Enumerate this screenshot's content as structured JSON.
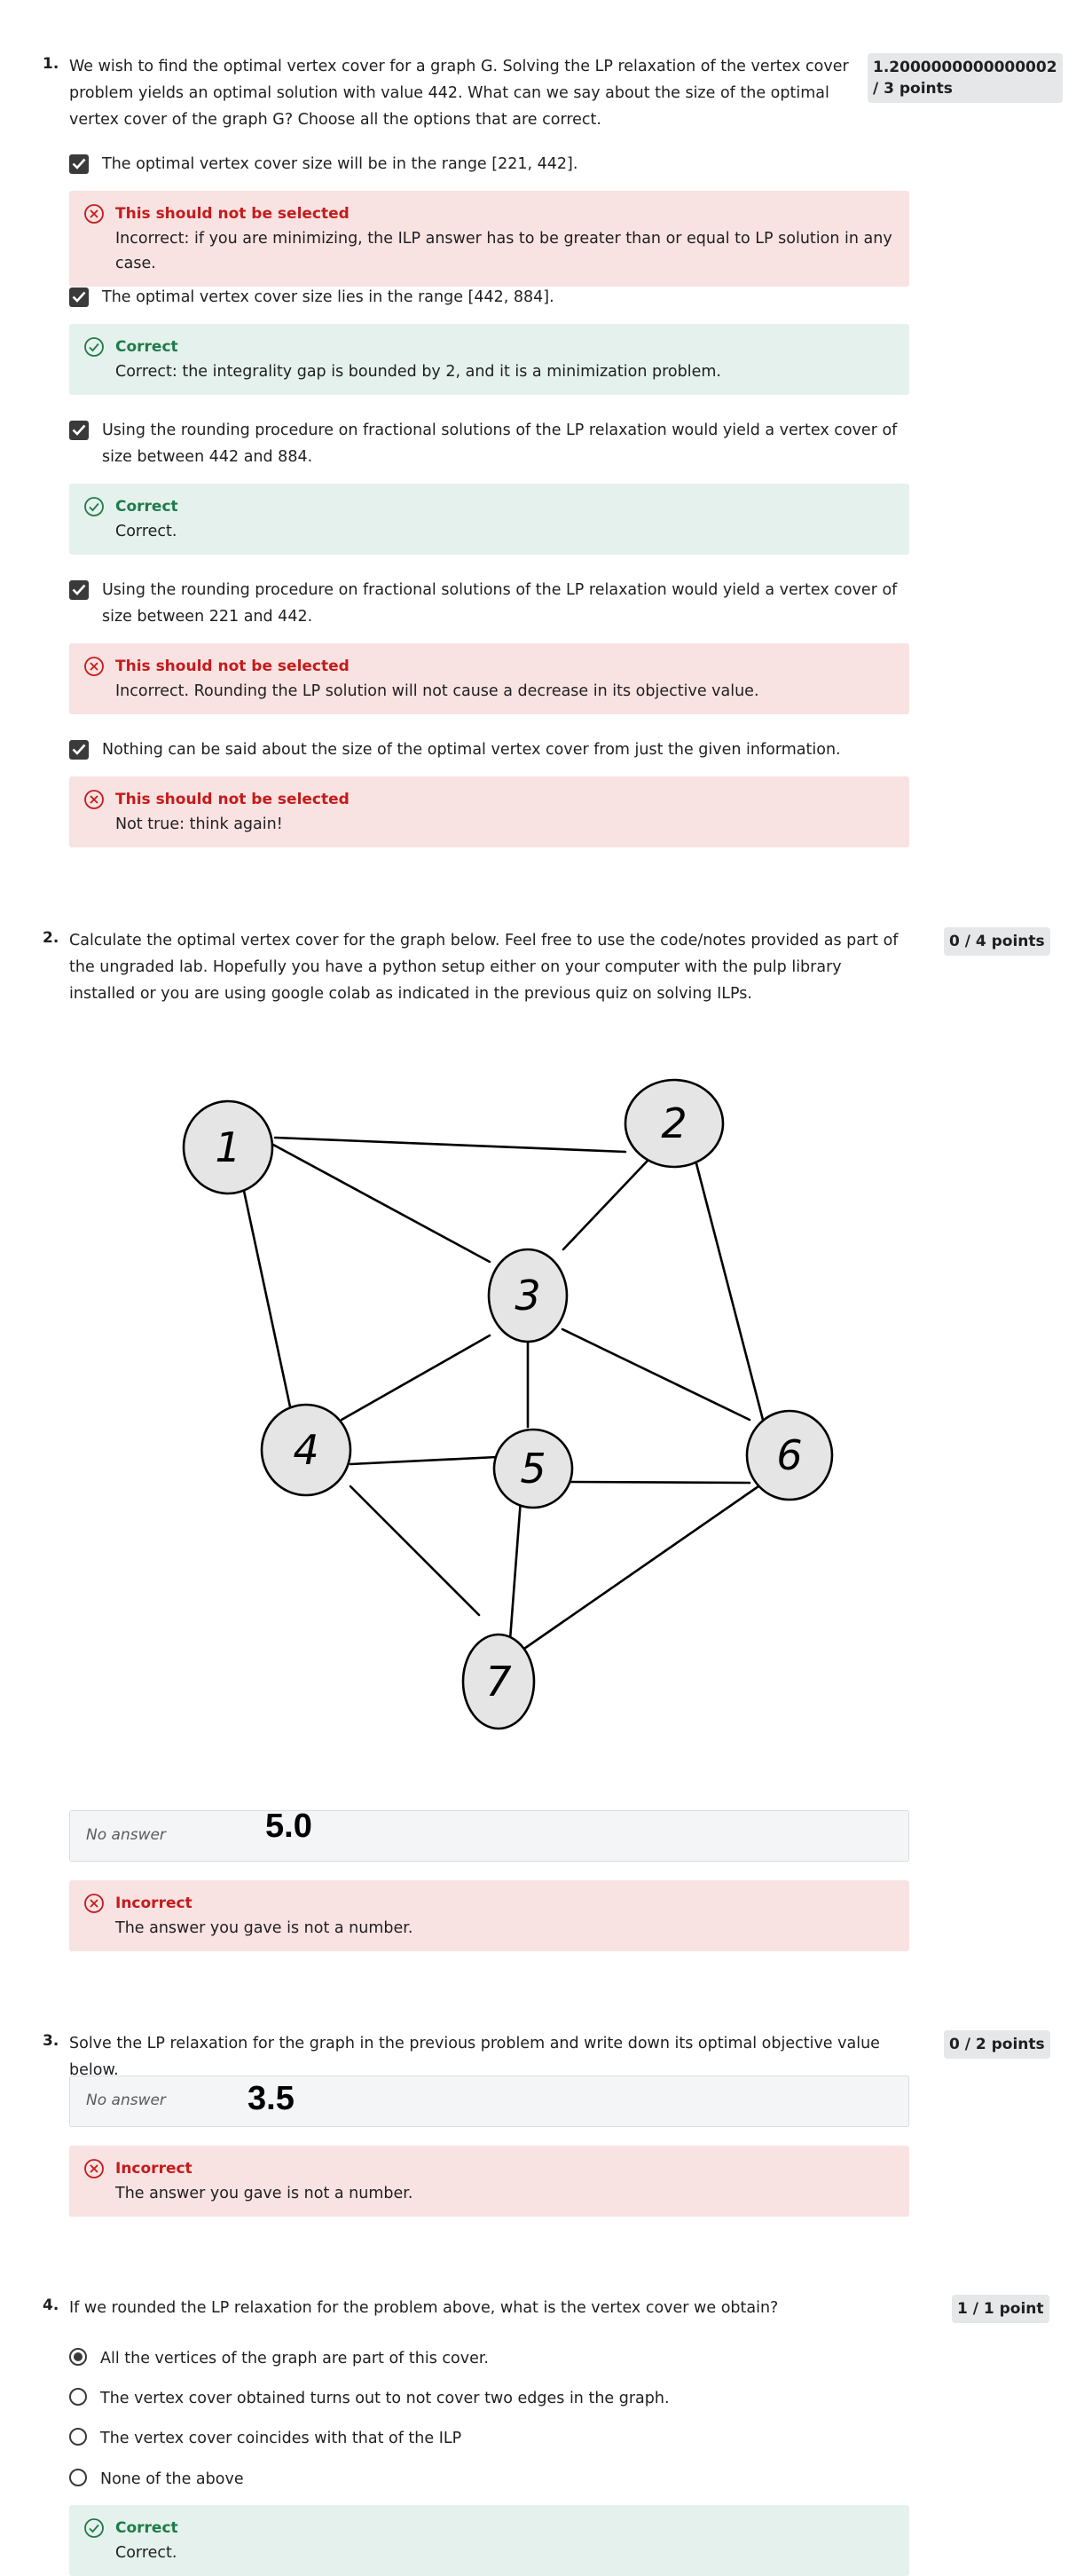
{
  "q1": {
    "number": "1.",
    "text": "We wish to find the optimal vertex cover for a graph G. Solving the LP relaxation of the vertex cover problem yields an optimal solution with value 442. What can we say about the size of the optimal vertex cover of the graph G? Choose all the options that are correct.",
    "points_line1": "1.2000000000000002",
    "points_line2": "/ 3 points",
    "options": [
      {
        "text": "The optimal vertex cover size will be in the range [221, 442].",
        "checked": true,
        "fb_title": "This should not be selected",
        "fb_msg": "Incorrect: if you are minimizing, the ILP answer has to be greater than or equal to LP solution in any case."
      },
      {
        "text": "The optimal vertex cover size lies in the range [442, 884].",
        "checked": true,
        "fb_title": "Correct",
        "fb_msg": "Correct: the integrality gap is bounded by 2, and it is a minimization problem."
      },
      {
        "text": "Using the rounding procedure on fractional solutions of the LP relaxation would yield a vertex cover of size between 442 and 884.",
        "checked": true,
        "fb_title": "Correct",
        "fb_msg": "Correct."
      },
      {
        "text": "Using the rounding procedure on fractional solutions of the LP relaxation would yield a vertex cover of size between 221 and 442.",
        "checked": true,
        "fb_title": "This should not be selected",
        "fb_msg": "Incorrect. Rounding the LP solution will not cause a decrease in its objective value."
      },
      {
        "text": "Nothing can be said about the size of the optimal vertex cover from just the given information.",
        "checked": true,
        "fb_title": "This should not be selected",
        "fb_msg": "Not true: think again!"
      }
    ]
  },
  "q2": {
    "number": "2.",
    "text": "Calculate the optimal vertex cover for the graph below. Feel free to use the code/notes provided as part of the ungraded lab. Hopefully you have a python setup either on your computer with the pulp library installed or you are using google colab as indicated in the previous quiz on solving ILPs.",
    "points": "0 / 4 points",
    "graph": {
      "node_labels": [
        "1",
        "2",
        "3",
        "4",
        "5",
        "6",
        "7"
      ],
      "edges": [
        [
          1,
          2
        ],
        [
          1,
          3
        ],
        [
          1,
          4
        ],
        [
          2,
          3
        ],
        [
          2,
          6
        ],
        [
          3,
          4
        ],
        [
          3,
          5
        ],
        [
          3,
          6
        ],
        [
          4,
          5
        ],
        [
          4,
          7
        ],
        [
          5,
          6
        ],
        [
          5,
          7
        ],
        [
          6,
          7
        ]
      ]
    },
    "answer_placeholder": "No answer",
    "answer_value": "5.0",
    "fb_title": "Incorrect",
    "fb_msg": "The answer you gave is not a number."
  },
  "q3": {
    "number": "3.",
    "text": "Solve the LP relaxation for the graph in the previous problem and write down its optimal objective value below.",
    "points": "0 / 2 points",
    "answer_placeholder": "No answer",
    "answer_value": "3.5",
    "fb_title": "Incorrect",
    "fb_msg": "The answer you gave is not a number."
  },
  "q4": {
    "number": "4.",
    "text": "If we rounded the LP relaxation for the problem above, what is the vertex cover we obtain?",
    "points": "1 / 1 point",
    "options": [
      "All the vertices of the graph are part of this cover.",
      "The vertex cover obtained turns out to not cover two edges in the graph.",
      "The vertex cover coincides with that of the ILP",
      "None of the above"
    ],
    "selected_index": 0,
    "fb_title": "Correct",
    "fb_msg": "Correct."
  },
  "colors": {
    "correct": "#1e7b4a",
    "incorrect": "#c51b1b",
    "correct_bg": "#e5f1ec",
    "incorrect_bg": "#f9e2e2"
  }
}
